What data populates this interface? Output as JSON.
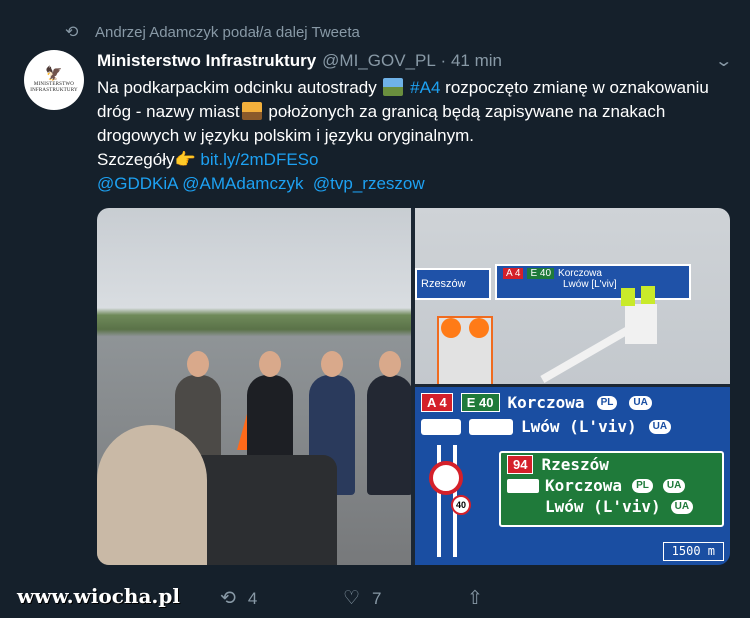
{
  "retweet": {
    "icon": "retweet-icon",
    "text": "Andrzej Adamczyk podał/a dalej Tweeta"
  },
  "author": {
    "avatar_text": "MINISTERSTWO INFRASTRUKTURY",
    "name": "Ministerstwo Infrastruktury",
    "handle": "@MI_GOV_PL",
    "separator": "·",
    "time": "41 min"
  },
  "tweet": {
    "part1": "Na podkarpackim odcinku autostrady",
    "hashtag": "#A4",
    "part2": "rozpoczęto zmianę w oznakowaniu dróg - nazwy miast",
    "part3": "położonych za granicą będą zapisywane na znakach drogowych w języku polskim i języku oryginalnym.",
    "details_label": "Szczegóły",
    "emoji_point": "👉",
    "link": "bit.ly/2mDFESo",
    "mention1": "@GDDKiA",
    "mention2": "@AMAdamczyk",
    "mention3": "@tvp_rzeszow"
  },
  "media": {
    "top_sign": {
      "left_city": "Rzeszów",
      "badge_a4": "A 4",
      "badge_e40": "E 40",
      "city1": "Korczowa",
      "city2": "Lwów [L'viv]"
    },
    "sign": {
      "badge_a4": "A 4",
      "badge_e40": "E 40",
      "row1_city": "Korczowa",
      "row1_pill1": "PL",
      "row1_pill2": "UA",
      "row2_city": "Lwów (L'viv)",
      "row2_pill": "UA",
      "speed": "40",
      "panel_badge": "94",
      "panel_city1": "Rzeszów",
      "panel_city2": "Korczowa",
      "panel_city2_pill1": "PL",
      "panel_city2_pill2": "UA",
      "panel_city3": "Lwów (L'viv)",
      "panel_city3_pill": "UA",
      "distance": "1500 m"
    }
  },
  "actions": {
    "reply_count": "",
    "retweet_count": "4",
    "like_count": "7",
    "share_icon": "share-icon"
  },
  "watermark": "www.wiocha.pl",
  "colors": {
    "background": "#15202b",
    "link": "#1da1f2",
    "muted": "#8899a6",
    "sign_blue": "#1a4ea2",
    "sign_green": "#1f7a3a"
  }
}
